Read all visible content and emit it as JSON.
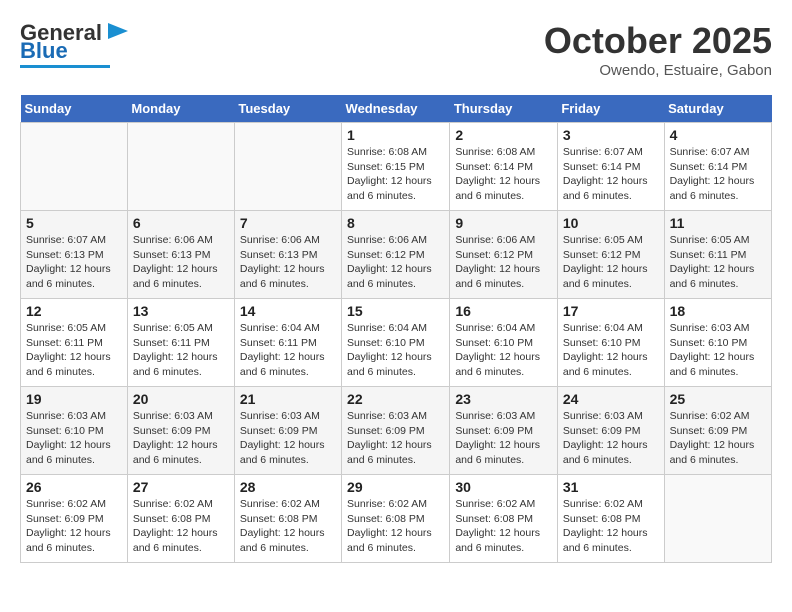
{
  "header": {
    "logo_line1": "General",
    "logo_line2": "Blue",
    "month": "October 2025",
    "location": "Owendo, Estuaire, Gabon"
  },
  "days_of_week": [
    "Sunday",
    "Monday",
    "Tuesday",
    "Wednesday",
    "Thursday",
    "Friday",
    "Saturday"
  ],
  "weeks": [
    [
      {
        "day": "",
        "info": ""
      },
      {
        "day": "",
        "info": ""
      },
      {
        "day": "",
        "info": ""
      },
      {
        "day": "1",
        "info": "Sunrise: 6:08 AM\nSunset: 6:15 PM\nDaylight: 12 hours and 6 minutes."
      },
      {
        "day": "2",
        "info": "Sunrise: 6:08 AM\nSunset: 6:14 PM\nDaylight: 12 hours and 6 minutes."
      },
      {
        "day": "3",
        "info": "Sunrise: 6:07 AM\nSunset: 6:14 PM\nDaylight: 12 hours and 6 minutes."
      },
      {
        "day": "4",
        "info": "Sunrise: 6:07 AM\nSunset: 6:14 PM\nDaylight: 12 hours and 6 minutes."
      }
    ],
    [
      {
        "day": "5",
        "info": "Sunrise: 6:07 AM\nSunset: 6:13 PM\nDaylight: 12 hours and 6 minutes."
      },
      {
        "day": "6",
        "info": "Sunrise: 6:06 AM\nSunset: 6:13 PM\nDaylight: 12 hours and 6 minutes."
      },
      {
        "day": "7",
        "info": "Sunrise: 6:06 AM\nSunset: 6:13 PM\nDaylight: 12 hours and 6 minutes."
      },
      {
        "day": "8",
        "info": "Sunrise: 6:06 AM\nSunset: 6:12 PM\nDaylight: 12 hours and 6 minutes."
      },
      {
        "day": "9",
        "info": "Sunrise: 6:06 AM\nSunset: 6:12 PM\nDaylight: 12 hours and 6 minutes."
      },
      {
        "day": "10",
        "info": "Sunrise: 6:05 AM\nSunset: 6:12 PM\nDaylight: 12 hours and 6 minutes."
      },
      {
        "day": "11",
        "info": "Sunrise: 6:05 AM\nSunset: 6:11 PM\nDaylight: 12 hours and 6 minutes."
      }
    ],
    [
      {
        "day": "12",
        "info": "Sunrise: 6:05 AM\nSunset: 6:11 PM\nDaylight: 12 hours and 6 minutes."
      },
      {
        "day": "13",
        "info": "Sunrise: 6:05 AM\nSunset: 6:11 PM\nDaylight: 12 hours and 6 minutes."
      },
      {
        "day": "14",
        "info": "Sunrise: 6:04 AM\nSunset: 6:11 PM\nDaylight: 12 hours and 6 minutes."
      },
      {
        "day": "15",
        "info": "Sunrise: 6:04 AM\nSunset: 6:10 PM\nDaylight: 12 hours and 6 minutes."
      },
      {
        "day": "16",
        "info": "Sunrise: 6:04 AM\nSunset: 6:10 PM\nDaylight: 12 hours and 6 minutes."
      },
      {
        "day": "17",
        "info": "Sunrise: 6:04 AM\nSunset: 6:10 PM\nDaylight: 12 hours and 6 minutes."
      },
      {
        "day": "18",
        "info": "Sunrise: 6:03 AM\nSunset: 6:10 PM\nDaylight: 12 hours and 6 minutes."
      }
    ],
    [
      {
        "day": "19",
        "info": "Sunrise: 6:03 AM\nSunset: 6:10 PM\nDaylight: 12 hours and 6 minutes."
      },
      {
        "day": "20",
        "info": "Sunrise: 6:03 AM\nSunset: 6:09 PM\nDaylight: 12 hours and 6 minutes."
      },
      {
        "day": "21",
        "info": "Sunrise: 6:03 AM\nSunset: 6:09 PM\nDaylight: 12 hours and 6 minutes."
      },
      {
        "day": "22",
        "info": "Sunrise: 6:03 AM\nSunset: 6:09 PM\nDaylight: 12 hours and 6 minutes."
      },
      {
        "day": "23",
        "info": "Sunrise: 6:03 AM\nSunset: 6:09 PM\nDaylight: 12 hours and 6 minutes."
      },
      {
        "day": "24",
        "info": "Sunrise: 6:03 AM\nSunset: 6:09 PM\nDaylight: 12 hours and 6 minutes."
      },
      {
        "day": "25",
        "info": "Sunrise: 6:02 AM\nSunset: 6:09 PM\nDaylight: 12 hours and 6 minutes."
      }
    ],
    [
      {
        "day": "26",
        "info": "Sunrise: 6:02 AM\nSunset: 6:09 PM\nDaylight: 12 hours and 6 minutes."
      },
      {
        "day": "27",
        "info": "Sunrise: 6:02 AM\nSunset: 6:08 PM\nDaylight: 12 hours and 6 minutes."
      },
      {
        "day": "28",
        "info": "Sunrise: 6:02 AM\nSunset: 6:08 PM\nDaylight: 12 hours and 6 minutes."
      },
      {
        "day": "29",
        "info": "Sunrise: 6:02 AM\nSunset: 6:08 PM\nDaylight: 12 hours and 6 minutes."
      },
      {
        "day": "30",
        "info": "Sunrise: 6:02 AM\nSunset: 6:08 PM\nDaylight: 12 hours and 6 minutes."
      },
      {
        "day": "31",
        "info": "Sunrise: 6:02 AM\nSunset: 6:08 PM\nDaylight: 12 hours and 6 minutes."
      },
      {
        "day": "",
        "info": ""
      }
    ]
  ]
}
